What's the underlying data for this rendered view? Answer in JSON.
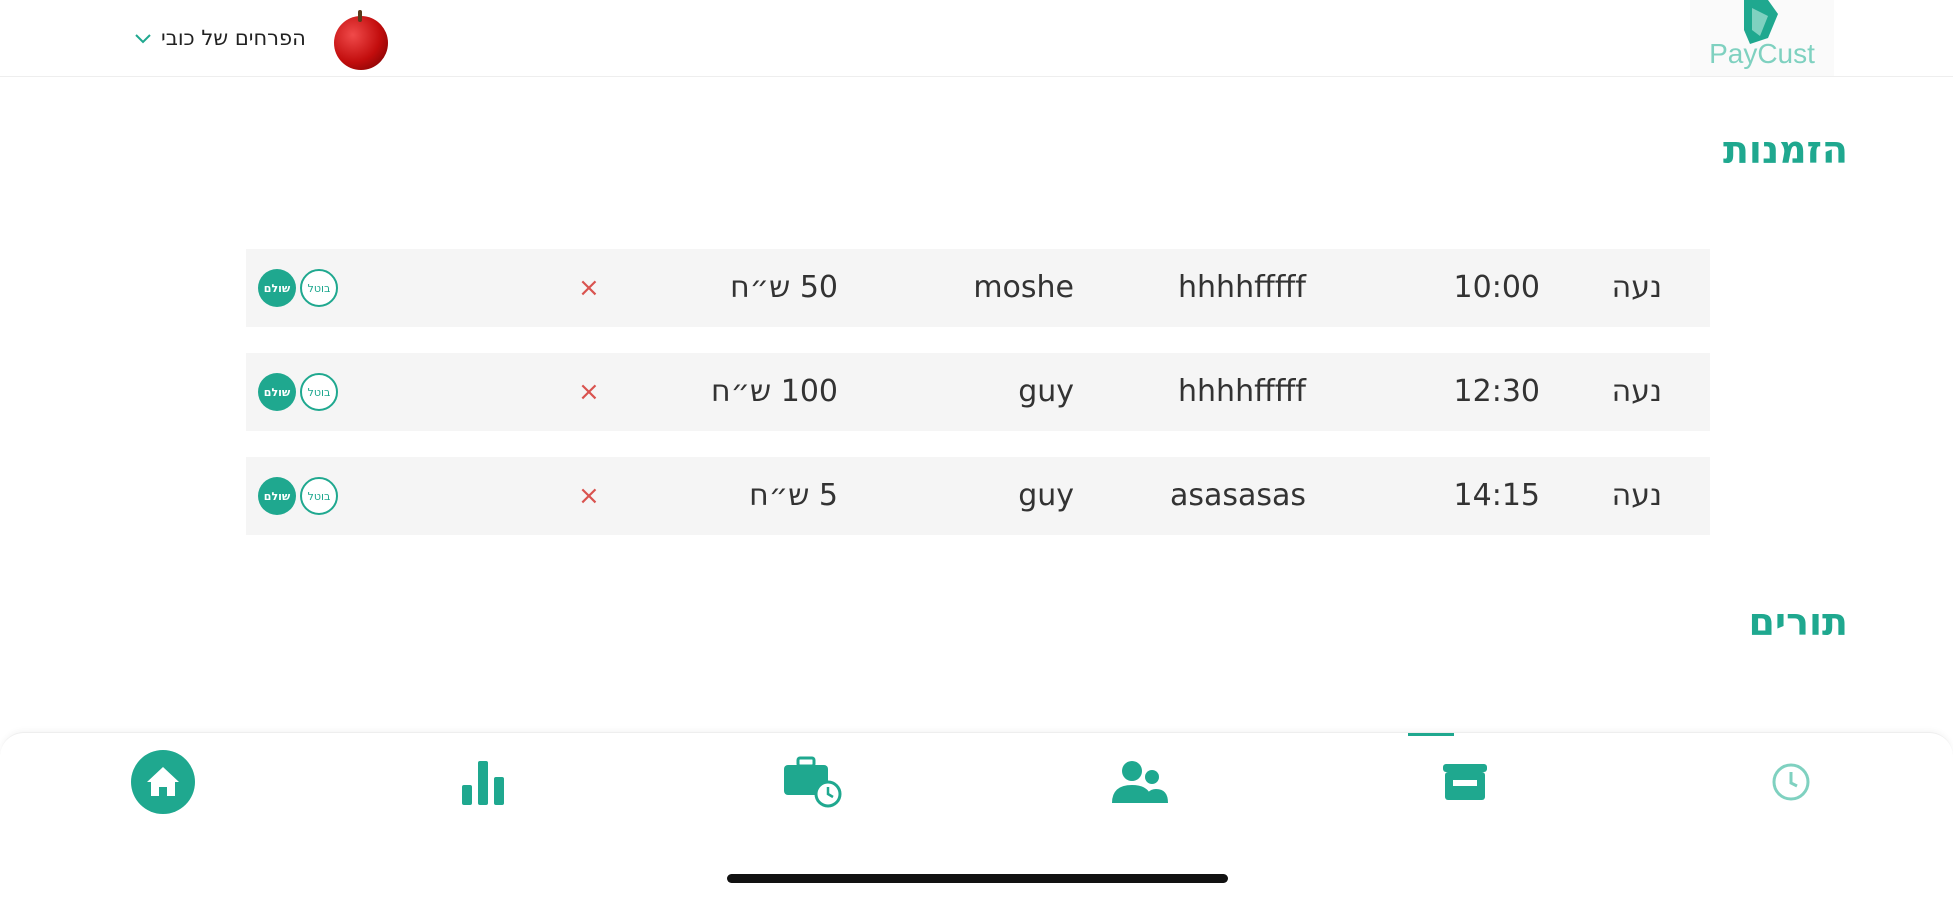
{
  "header": {
    "logo_text": "PayCust",
    "business_name": "הפרחים של כובי"
  },
  "orders": {
    "title": "הזמנות",
    "rows": [
      {
        "name": "נעה",
        "time": "10:00",
        "description": "hhhhfffff",
        "customer": "moshe",
        "price": "50 ש״ח",
        "remove": "×",
        "action_primary": "שולם",
        "action_secondary": "בוטל"
      },
      {
        "name": "נעה",
        "time": "12:30",
        "description": "hhhhfffff",
        "customer": "guy",
        "price": "100 ש״ח",
        "remove": "×",
        "action_primary": "שולם",
        "action_secondary": "בוטל"
      },
      {
        "name": "נעה",
        "time": "14:15",
        "description": "asasasas",
        "customer": "guy",
        "price": "5 ש״ח",
        "remove": "×",
        "action_primary": "שולם",
        "action_secondary": "בוטל"
      }
    ]
  },
  "appointments": {
    "title": "תורים"
  },
  "bottom_nav": {
    "items": [
      {
        "icon": "home-icon"
      },
      {
        "icon": "bar-chart-icon"
      },
      {
        "icon": "briefcase-clock-icon"
      },
      {
        "icon": "users-icon"
      },
      {
        "icon": "store-icon"
      },
      {
        "icon": "clock-icon"
      }
    ]
  },
  "colors": {
    "accent": "#1fa88f",
    "row_background": "#f5f5f5",
    "remove": "#d9534f"
  }
}
